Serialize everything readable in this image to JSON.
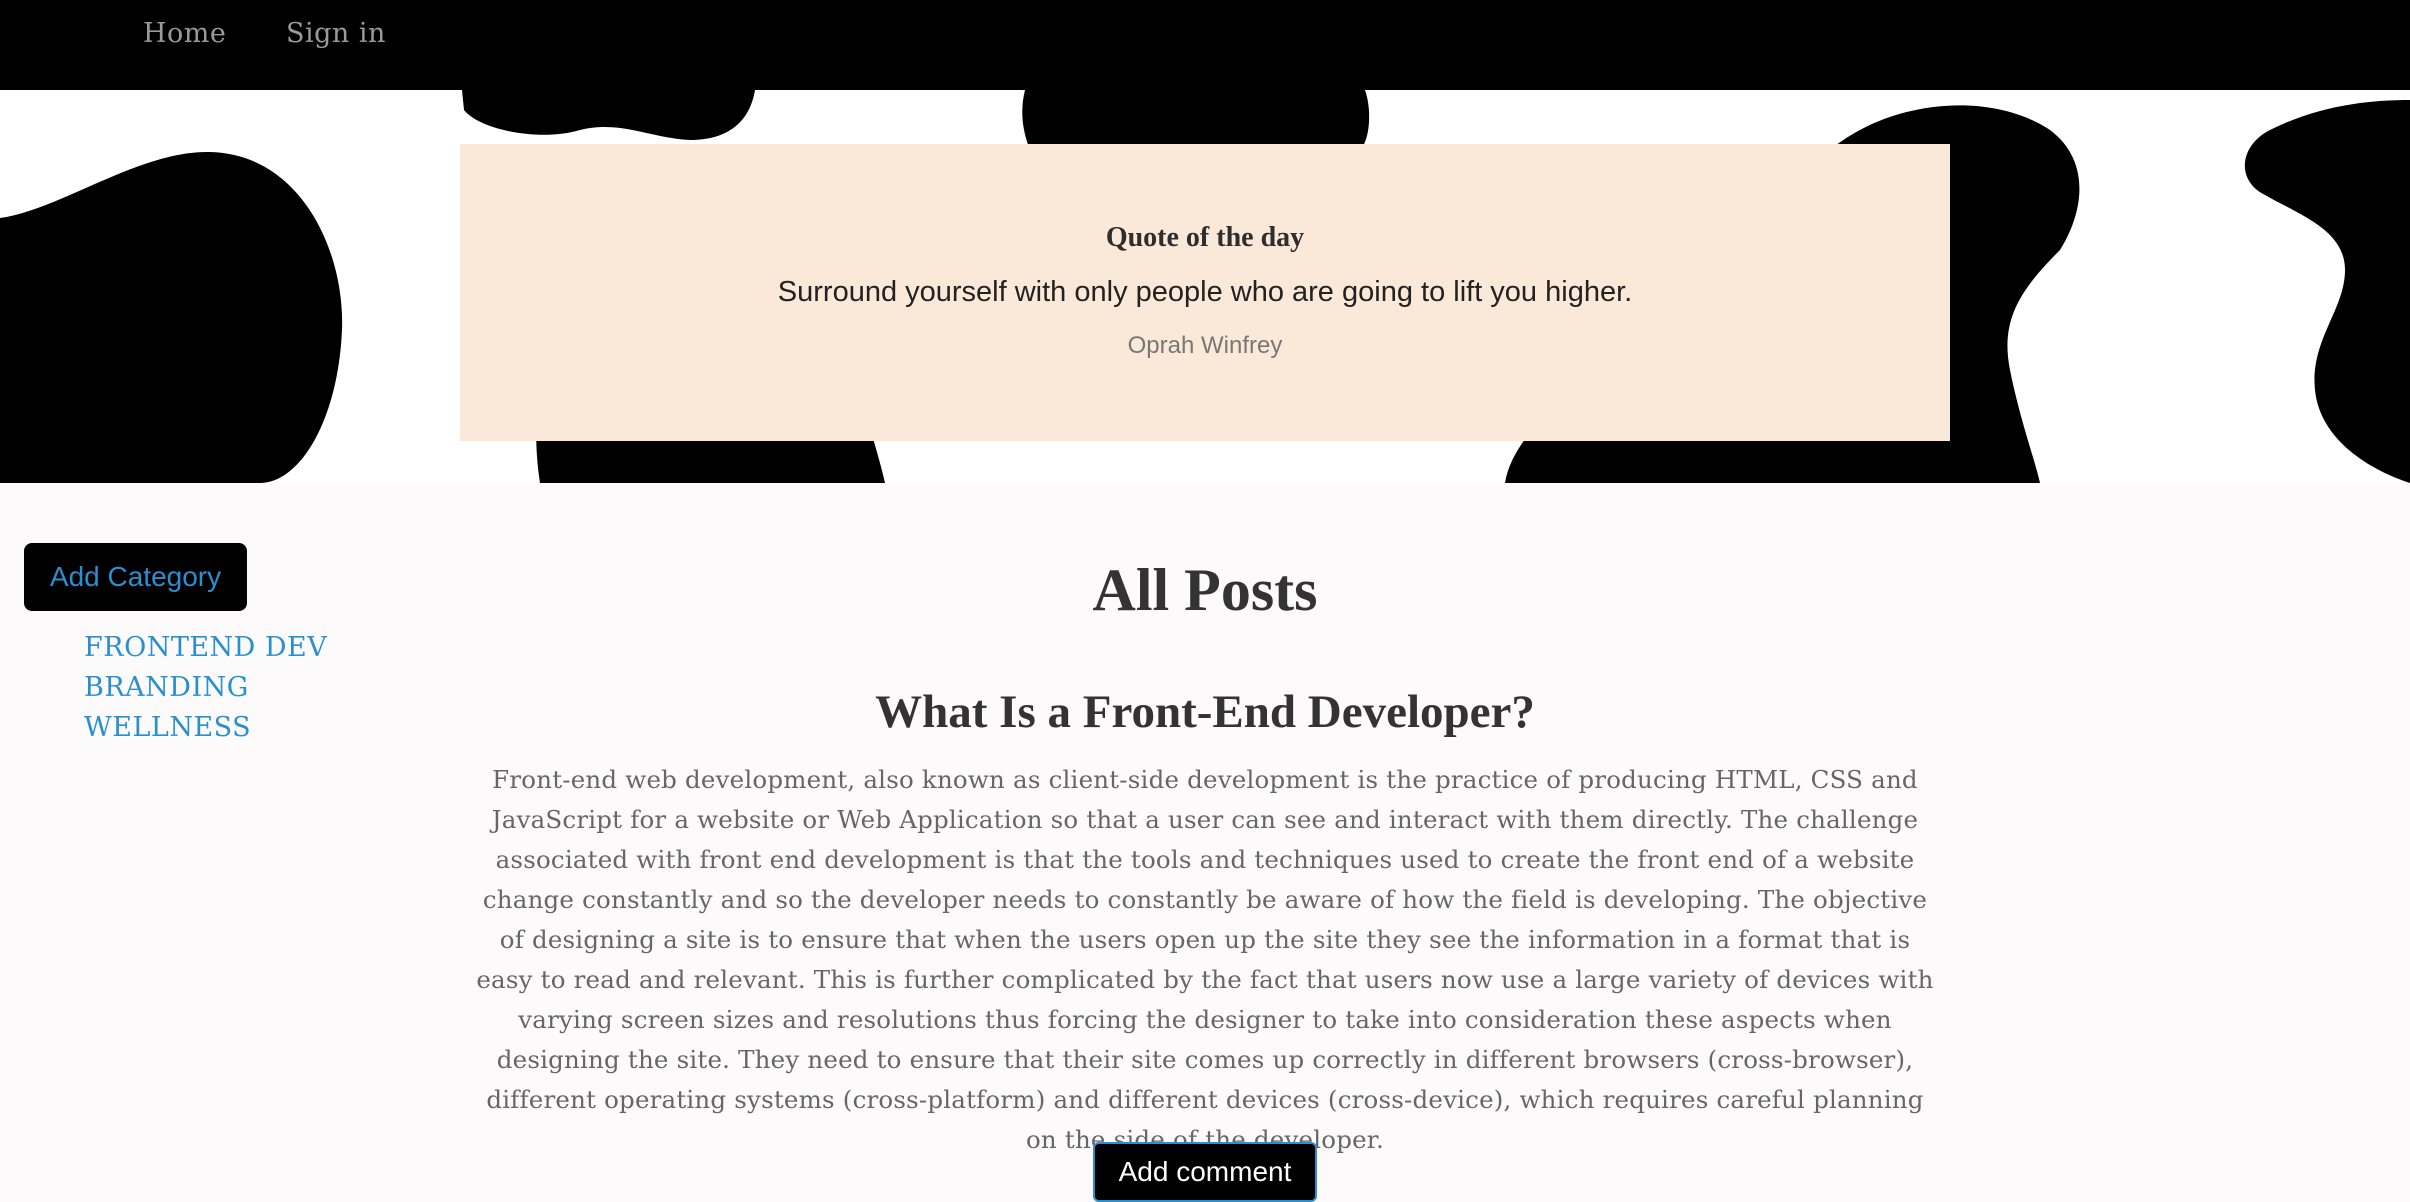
{
  "nav": {
    "home_label": "Home",
    "signin_label": "Sign in"
  },
  "quote": {
    "heading": "Quote of the day",
    "text": "Surround yourself with only people who are going to lift you higher.",
    "author": "Oprah Winfrey"
  },
  "sidebar": {
    "add_category_label": "Add Category",
    "categories": [
      "FRONTEND DEV",
      "BRANDING",
      "WELLNESS"
    ]
  },
  "main": {
    "title": "All Posts",
    "post": {
      "title": "What Is a Front-End Developer?",
      "body": "Front-end web development, also known as client-side development is the practice of producing HTML, CSS and JavaScript for a website or Web Application so that a user can see and interact with them directly. The challenge associated with front end development is that the tools and techniques used to create the front end of a website change constantly and so the developer needs to constantly be aware of how the field is developing. The objective of designing a site is to ensure that when the users open up the site they see the information in a format that is easy to read and relevant. This is further complicated by the fact that users now use a large variety of devices with varying screen sizes and resolutions thus forcing the designer to take into consideration these aspects when designing the site. They need to ensure that their site comes up correctly in different browsers (cross-browser), different operating systems (cross-platform) and different devices (cross-device), which requires careful planning on the side of the developer.",
      "add_comment_label": "Add comment"
    }
  },
  "colors": {
    "nav_bg": "#000000",
    "accent": "#2a8fd0",
    "quote_bg": "#fae9d8",
    "page_bg": "#fcfafa"
  }
}
